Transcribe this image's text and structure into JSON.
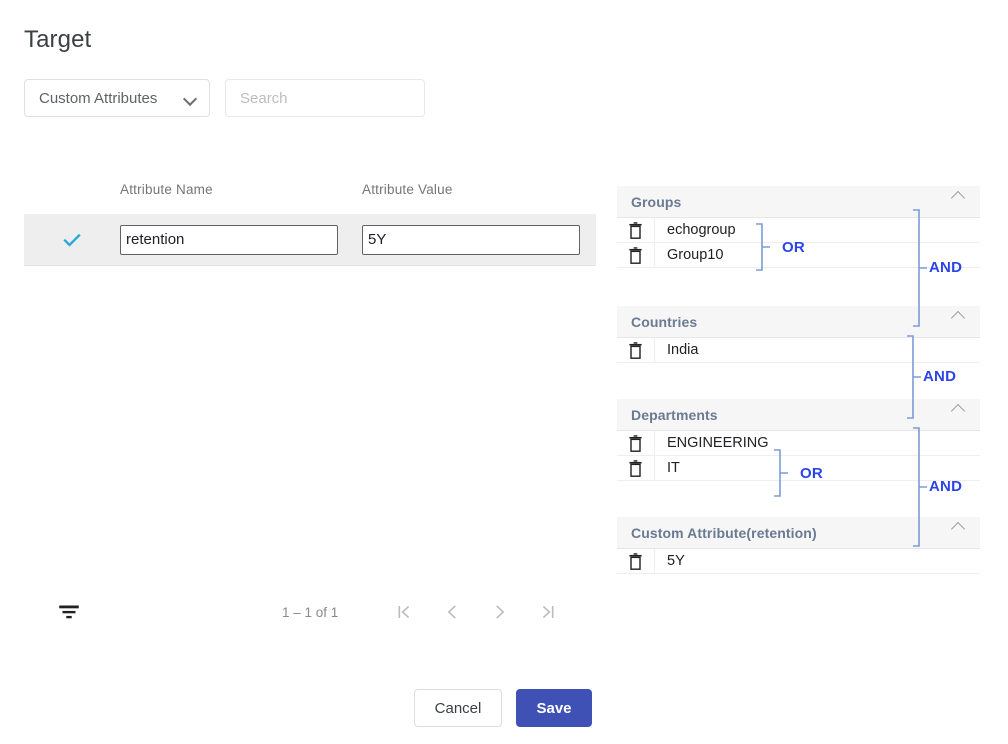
{
  "header": {
    "title": "Target"
  },
  "filter_bar": {
    "select": {
      "value": "Custom Attributes",
      "icon": "chevron-down-icon"
    },
    "search": {
      "value": "",
      "placeholder": "Search"
    }
  },
  "table": {
    "columns": [
      "",
      "Attribute Name",
      "Attribute Value"
    ],
    "rows": [
      {
        "selected": true,
        "attribute_name": "retention",
        "attribute_value": "5Y"
      }
    ]
  },
  "paginator": {
    "filter_icon": "filter-list-icon",
    "range_label": "1 – 1 of 1",
    "buttons": [
      {
        "name": "first-page-button",
        "icon": "first-page-icon"
      },
      {
        "name": "previous-page-button",
        "icon": "chevron-left-icon"
      },
      {
        "name": "next-page-button",
        "icon": "chevron-right-icon"
      },
      {
        "name": "last-page-button",
        "icon": "last-page-icon"
      }
    ]
  },
  "actions": {
    "cancel_label": "Cancel",
    "save_label": "Save"
  },
  "rules": {
    "groups": [
      {
        "title": "Groups",
        "items": [
          "echogroup",
          "Group10"
        ],
        "inner_operator": "OR",
        "outer_operator": "AND"
      },
      {
        "title": "Countries",
        "items": [
          "India"
        ],
        "inner_operator": "",
        "outer_operator": "AND"
      },
      {
        "title": "Departments",
        "items": [
          "ENGINEERING",
          "IT"
        ],
        "inner_operator": "OR",
        "outer_operator": "AND"
      },
      {
        "title": "Custom Attribute(retention)",
        "items": [
          "5Y"
        ],
        "inner_operator": "",
        "outer_operator": ""
      }
    ]
  },
  "colors": {
    "save_button": "#3f51b5",
    "checkmark": "#29a8e0",
    "operator_text": "#2b44e8",
    "bracket": "#7d9ad6",
    "section_header_text": "#6a7a92",
    "row_selected_bg": "#eeeeee"
  }
}
